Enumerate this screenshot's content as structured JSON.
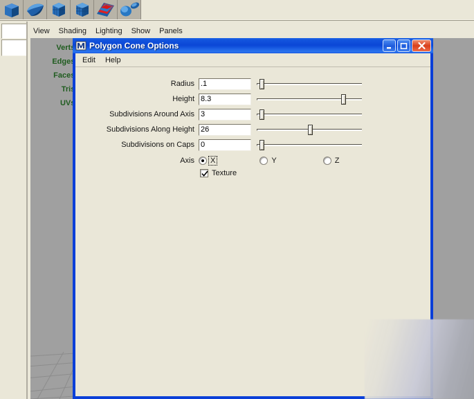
{
  "shelf": {
    "buttons": [
      {
        "name": "poly-cube-icon",
        "tooltip": "Polygon Cube"
      },
      {
        "name": "poly-sphere-icon",
        "tooltip": "Polygon Sphere"
      },
      {
        "name": "poly-cylinder-icon",
        "tooltip": "Polygon Cylinder"
      },
      {
        "name": "poly-cone-icon",
        "tooltip": "Polygon Cone"
      },
      {
        "name": "poly-plane-icon",
        "tooltip": "Polygon Plane"
      },
      {
        "name": "poly-torus-icon",
        "tooltip": "Polygon Torus"
      }
    ]
  },
  "viewport": {
    "menus": [
      "View",
      "Shading",
      "Lighting",
      "Show",
      "Panels"
    ],
    "hud": {
      "labels": [
        "Verts:",
        "Edges:",
        "Faces:",
        "Tris:",
        "UVs:"
      ],
      "color": "#1F5C1F"
    }
  },
  "dialog": {
    "title": "Polygon Cone Options",
    "icon": "maya-m-icon",
    "menus": [
      "Edit",
      "Help"
    ],
    "window_buttons": {
      "minimize": "minimize-icon",
      "maximize": "maximize-icon",
      "close": "close-icon"
    },
    "titlebar_color": "#0B47D6",
    "background_color": "#EAE7D8",
    "fields": [
      {
        "label": "Radius",
        "value": ".1",
        "slider_percent": 3
      },
      {
        "label": "Height",
        "value": "8.3",
        "slider_percent": 83
      },
      {
        "label": "Subdivisions Around Axis",
        "value": "3",
        "slider_percent": 3
      },
      {
        "label": "Subdivisions Along Height",
        "value": "26",
        "slider_percent": 50
      },
      {
        "label": "Subdivisions on Caps",
        "value": "0",
        "slider_percent": 3
      }
    ],
    "axis": {
      "label": "Axis",
      "options": [
        "X",
        "Y",
        "Z"
      ],
      "selected": "X"
    },
    "texture": {
      "label": "Texture",
      "checked": true
    }
  }
}
